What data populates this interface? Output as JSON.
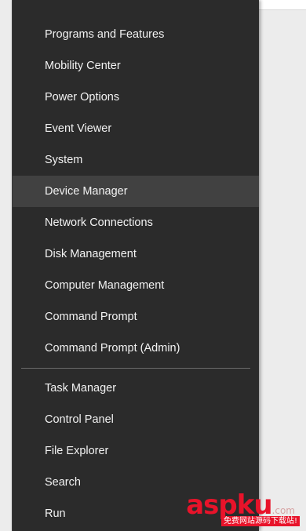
{
  "menu": {
    "items": [
      {
        "label": "Programs and Features"
      },
      {
        "label": "Mobility Center"
      },
      {
        "label": "Power Options"
      },
      {
        "label": "Event Viewer"
      },
      {
        "label": "System"
      },
      {
        "label": "Device Manager",
        "highlighted": true
      },
      {
        "label": "Network Connections"
      },
      {
        "label": "Disk Management"
      },
      {
        "label": "Computer Management"
      },
      {
        "label": "Command Prompt"
      },
      {
        "label": "Command Prompt (Admin)"
      }
    ],
    "items2": [
      {
        "label": "Task Manager"
      },
      {
        "label": "Control Panel"
      },
      {
        "label": "File Explorer"
      },
      {
        "label": "Search"
      },
      {
        "label": "Run"
      }
    ],
    "colors": {
      "background": "#2b2b2b",
      "highlight": "#414141",
      "text": "#f2f2f2",
      "separator": "#6a6a6a"
    }
  },
  "watermark": {
    "logo_text": "aspku",
    "logo_suffix": ".com",
    "tagline": "免费网站源码下载站!",
    "color": "#e8132a"
  }
}
